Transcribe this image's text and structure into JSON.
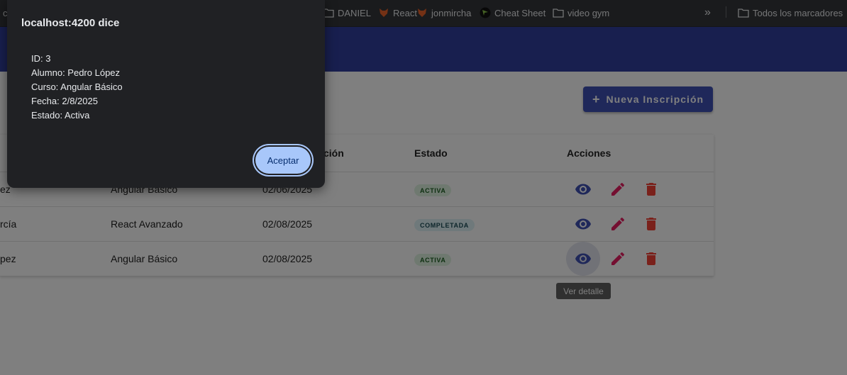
{
  "bookmarks": {
    "partial_label": "c",
    "items": [
      {
        "label": "DANIEL",
        "icon": "folder-icon"
      },
      {
        "label": "React",
        "icon": "fox-icon"
      },
      {
        "label": "jonmircha",
        "icon": "fox-icon"
      },
      {
        "label": "Cheat Sheet",
        "icon": "cheat-sheet-icon"
      },
      {
        "label": "video gym",
        "icon": "folder-icon"
      }
    ],
    "overflow": "»",
    "all_bookmarks": "Todos los marcadores"
  },
  "toolbar": {
    "new_button_label": "Nueva Inscripción"
  },
  "table": {
    "headers": {
      "fecha_partial": "ción",
      "estado": "Estado",
      "acciones": "Acciones"
    },
    "rows": [
      {
        "alumno": "ez",
        "curso": "Angular Básico",
        "fecha": "02/06/2025",
        "estado": "ACTIVA"
      },
      {
        "alumno": "rcía",
        "curso": "React Avanzado",
        "fecha": "02/08/2025",
        "estado": "COMPLETADA"
      },
      {
        "alumno": "pez",
        "curso": "Angular Básico",
        "fecha": "02/08/2025",
        "estado": "ACTIVA"
      }
    ],
    "tooltip": "Ver detalle"
  },
  "dialog": {
    "title": "localhost:4200 dice",
    "lines": [
      "ID: 3",
      "Alumno: Pedro López",
      "Curso: Angular Básico",
      "Fecha: 2/8/2025",
      "Estado: Activa"
    ],
    "accept_label": "Aceptar"
  },
  "colors": {
    "primary": "#3f51b5",
    "header": "#303f9f",
    "view_icon": "#3f51b5",
    "edit_icon": "#e91e63",
    "delete_icon": "#f44336",
    "dialog_button": "#a8c7fa"
  }
}
